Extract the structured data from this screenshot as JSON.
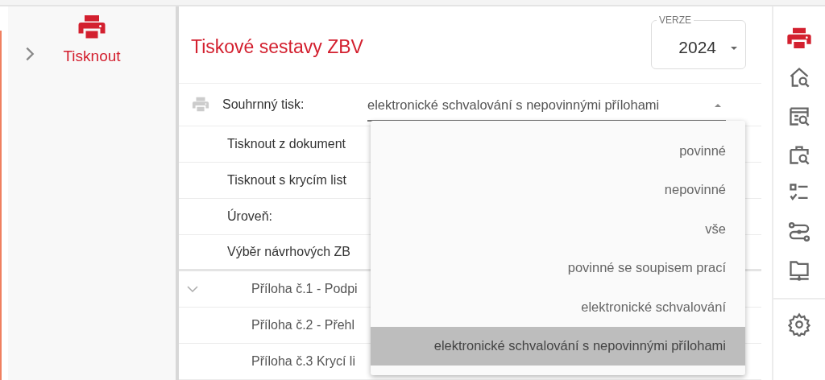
{
  "sidebar": {
    "label": "Tisknout",
    "collapsed": true
  },
  "title": "Tiskové sestavy ZBV",
  "version": {
    "label": "VERZE",
    "value": "2024"
  },
  "summary": {
    "label": "Souhrnný tisk:",
    "value": "elektronické schvalování s nepovinnými přílohami",
    "open": true
  },
  "rows": [
    {
      "label": "Tisknout z dokument"
    },
    {
      "label": "Tisknout s krycím list"
    },
    {
      "label": "Úroveň:"
    },
    {
      "label": "Výběr návrhových ZB"
    }
  ],
  "attachments": [
    {
      "label": "Příloha č.1 - Podpi",
      "kind": "toggle",
      "expanded": true
    },
    {
      "label": "Příloha č.2 - Přehl",
      "kind": "leaf"
    },
    {
      "label": "Příloha č.3 Krycí li",
      "kind": "leaf"
    }
  ],
  "options": [
    {
      "label": "povinné",
      "selected": false
    },
    {
      "label": "nepovinné",
      "selected": false
    },
    {
      "label": "vše",
      "selected": false
    },
    {
      "label": "povinné se soupisem prací",
      "selected": false
    },
    {
      "label": "elektronické schvalování",
      "selected": false
    },
    {
      "label": "elektronické schvalování s nepovinnými přílohami",
      "selected": true
    }
  ],
  "rail": [
    {
      "selected": true
    },
    {
      "selected": false
    },
    {
      "selected": false
    },
    {
      "selected": false
    },
    {
      "selected": false
    },
    {
      "selected": false
    },
    {
      "selected": false
    }
  ]
}
